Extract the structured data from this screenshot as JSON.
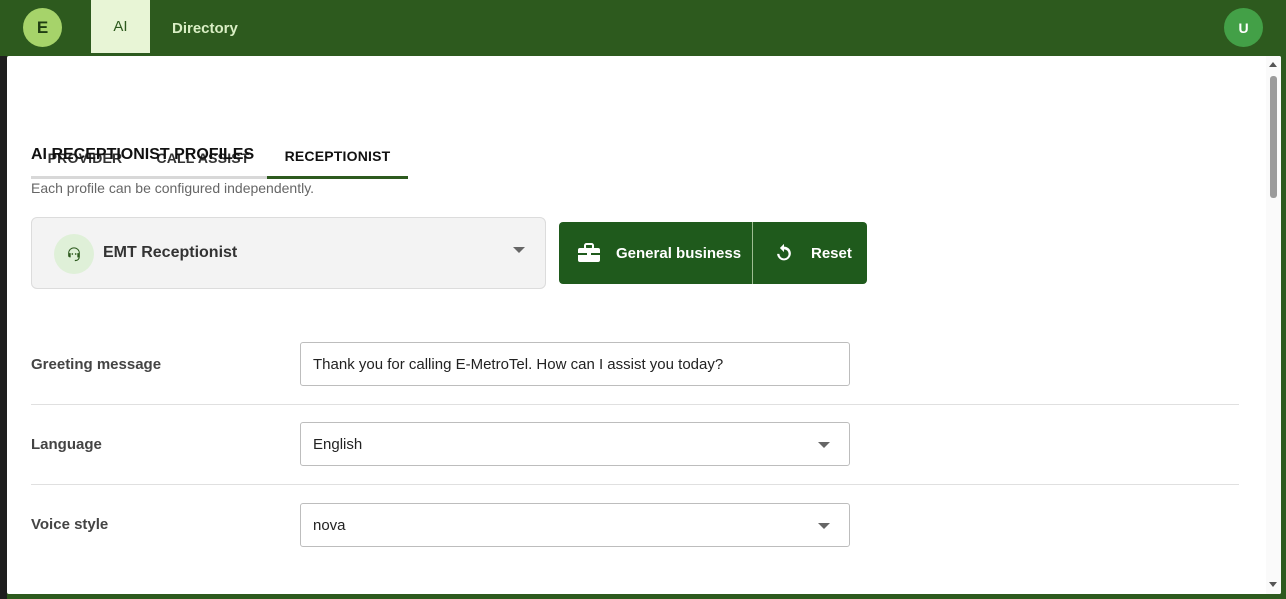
{
  "topbar": {
    "logo_letter": "E",
    "nav": [
      {
        "label": "AI",
        "active": true
      },
      {
        "label": "Directory",
        "active": false
      }
    ],
    "user_initial": "U"
  },
  "tabs": [
    {
      "label": "PROVIDER",
      "active": false
    },
    {
      "label": "CALL ASSIST",
      "active": false
    },
    {
      "label": "RECEPTIONIST",
      "active": true
    }
  ],
  "section": {
    "title": "AI RECEPTIONIST PROFILES",
    "subtitle": "Each profile can be configured independently."
  },
  "profile": {
    "selected": "EMT Receptionist",
    "icon": "support-agent-icon"
  },
  "actions": {
    "template_label": "General business",
    "template_icon": "briefcase-icon",
    "reset_label": "Reset",
    "reset_icon": "refresh-icon"
  },
  "form": {
    "greeting": {
      "label": "Greeting message",
      "value": "Thank you for calling E-MetroTel. How can I assist you today?"
    },
    "language": {
      "label": "Language",
      "value": "English"
    },
    "voice": {
      "label": "Voice style",
      "value": "nova"
    }
  },
  "colors": {
    "header_bg": "#2d5a1e",
    "accent": "#1f5a1c",
    "active_nav_bg": "#e8f5d6"
  }
}
